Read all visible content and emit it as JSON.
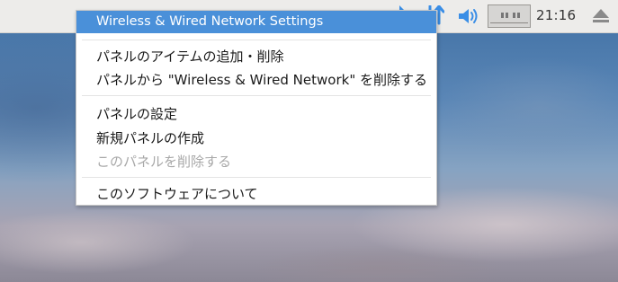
{
  "taskbar": {
    "clock": "21:16",
    "icons": {
      "network": "network-transfer-icon",
      "volume": "speaker-volume-icon",
      "cpu": "cpu-monitor-icon",
      "eject": "eject-icon"
    }
  },
  "menu": {
    "header": "Wireless & Wired Network Settings",
    "items": [
      "パネルのアイテムの追加・削除",
      "パネルから \"Wireless & Wired Network\" を削除する",
      "パネルの設定",
      "新規パネルの作成",
      "このパネルを削除する",
      "このソフトウェアについて"
    ]
  },
  "colors": {
    "highlight": "#4a90d9",
    "taskbar": "#edecea",
    "network_icon": "#3a8ee6",
    "disabled_text": "#a8a8a8"
  }
}
